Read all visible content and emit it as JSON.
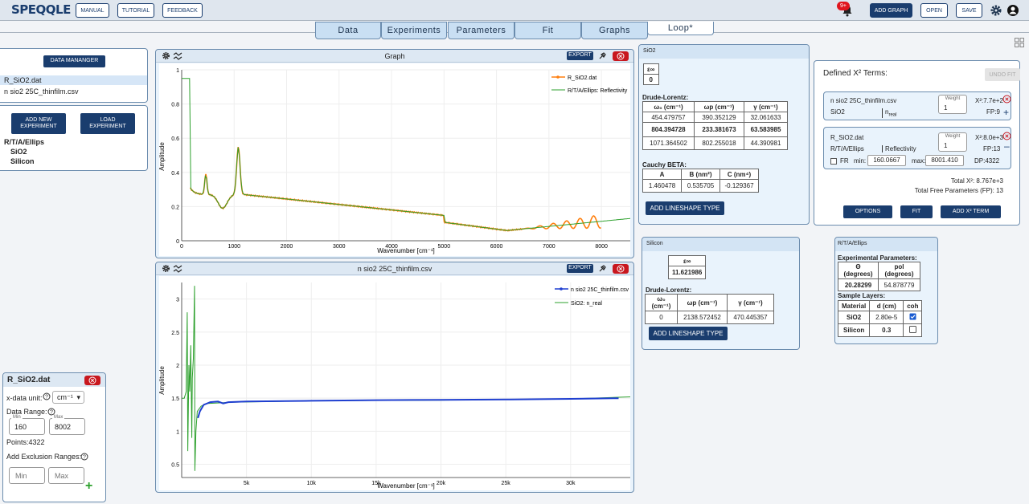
{
  "topbar": {
    "logo": "SPEQQLE",
    "manual": "MANUAL",
    "tutorial": "TUTORIAL",
    "feedback": "FEEDBACK",
    "notif_badge": "9+",
    "add_graph": "ADD GRAPH",
    "open": "OPEN",
    "save": "SAVE"
  },
  "tabs": [
    {
      "label": "Data"
    },
    {
      "label": "Experiments"
    },
    {
      "label": "Parameters"
    },
    {
      "label": "Fit"
    },
    {
      "label": "Graphs"
    },
    {
      "label": "Loop*"
    }
  ],
  "data_manager": {
    "button": "DATA MANANGER",
    "files": [
      "R_SiO2.dat",
      "n sio2 25C_thinfilm.csv"
    ]
  },
  "experiments": {
    "add_new": "ADD NEW EXPERIMENT",
    "load": "LOAD EXPERIMENT",
    "name": "R/T/A/Ellips",
    "layers": [
      "SiO2",
      "Silicon"
    ]
  },
  "file_settings": {
    "title": "R_SiO2.dat",
    "xunit_label": "x-data unit:",
    "xunit_value": "cm⁻¹",
    "range_label": "Data Range:",
    "min_label": "Min",
    "max_label": "Max",
    "min_value": "160",
    "max_value": "8002",
    "points": "Points:4322",
    "exclusion_label": "Add Exclusion Ranges:",
    "excl_min_ph": "Min",
    "excl_max_ph": "Max"
  },
  "graph1": {
    "title": "Graph",
    "export": "EXPORT",
    "ylabel": "Amplitude",
    "xlabel": "Wavenumber [cm⁻¹]",
    "legend": [
      "R_SiO2.dat",
      "R/T/A/Ellips: Reflectivity"
    ],
    "yticks": [
      "1",
      "0.8",
      "0.6",
      "0.4",
      "0.2",
      "0"
    ],
    "xticks": [
      "0",
      "1000",
      "2000",
      "3000",
      "4000",
      "5000",
      "6000",
      "7000",
      "8000"
    ]
  },
  "graph2": {
    "title": "n sio2 25C_thinfilm.csv",
    "export": "EXPORT",
    "ylabel": "Amplitude",
    "xlabel": "Wavenumber [cm⁻¹]",
    "legend": [
      "n sio2 25C_thinfilm.csv",
      "SiO2: n_real"
    ],
    "yticks": [
      "3",
      "2.5",
      "2",
      "1.5",
      "1",
      "0.5"
    ],
    "xticks": [
      "5k",
      "10k",
      "15k",
      "20k",
      "25k",
      "30k"
    ]
  },
  "sio2": {
    "title": "SiO2",
    "einf_label": "ε∞",
    "einf_value": "0",
    "drude_label": "Drude-Lorentz:",
    "headers": [
      "ω₀ (cm⁻¹)",
      "ωp (cm⁻¹)",
      "γ (cm⁻¹)"
    ],
    "rows": [
      [
        "454.479757",
        "390.352129",
        "32.061633"
      ],
      [
        "804.394728",
        "233.381673",
        "63.583985"
      ],
      [
        "1071.364502",
        "802.255018",
        "44.390981"
      ]
    ],
    "cauchy_label": "Cauchy BETA:",
    "cauchy_headers": [
      "A",
      "B (nm²)",
      "C (nm⁴)"
    ],
    "cauchy_values": [
      "1.460478",
      "0.535705",
      "-0.129367"
    ],
    "add_lineshape": "ADD LINESHAPE TYPE"
  },
  "silicon": {
    "title": "Silicon",
    "einf_label": "ε∞",
    "einf_value": "11.621986",
    "drude_label": "Drude-Lorentz:",
    "headers": [
      "ω₀ (cm⁻¹)",
      "ωp (cm⁻¹)",
      "γ (cm⁻¹)"
    ],
    "row": [
      "0",
      "2138.572452",
      "470.445357"
    ],
    "add_lineshape": "ADD LINESHAPE TYPE"
  },
  "rtae": {
    "title": "R/T/A/Ellips",
    "exp_params_label": "Experimental Parameters:",
    "param_headers": [
      "Θ (degrees)",
      "pol (degrees)"
    ],
    "param_values": [
      "20.28299",
      "54.878779"
    ],
    "layers_label": "Sample Layers:",
    "layer_headers": [
      "Material",
      "d (cm)",
      "coh"
    ],
    "layers": [
      [
        "SiO2",
        "2.80e-5"
      ],
      [
        "Silicon",
        "0.3"
      ]
    ]
  },
  "x2": {
    "title": "Defined X² Terms:",
    "undo": "UNDO FIT",
    "term1": {
      "file": "n sio2 25C_thinfilm.csv",
      "layer": "SiO2",
      "quantity": "n_real",
      "weight_label": "Weight",
      "weight": "1",
      "x2": "X²:7.7e+2",
      "fp": "FP:9"
    },
    "term2": {
      "file": "R_SiO2.dat",
      "layer": "R/T/A/Ellips",
      "quantity": "Reflectivity",
      "weight_label": "Weight",
      "weight": "1",
      "x2": "X²:8.0e+3",
      "fp": "FP:13",
      "fr": "FR",
      "min_label": "min:",
      "min": "160.0667",
      "max_label": "max:",
      "max": "8001.410",
      "dp": "DP:4322"
    },
    "total": "Total X²: 8.767e+3",
    "total_fp": "Total Free Parameters (FP): 13",
    "options": "OPTIONS",
    "fit": "FIT",
    "add_term": "ADD X² TERM"
  },
  "colors": {
    "brand": "#1a3d6e",
    "close": "#c8171e",
    "data_orange": "#ff7f0e",
    "fit_green": "#2ca02c",
    "data_blue": "#1f3fd0"
  }
}
